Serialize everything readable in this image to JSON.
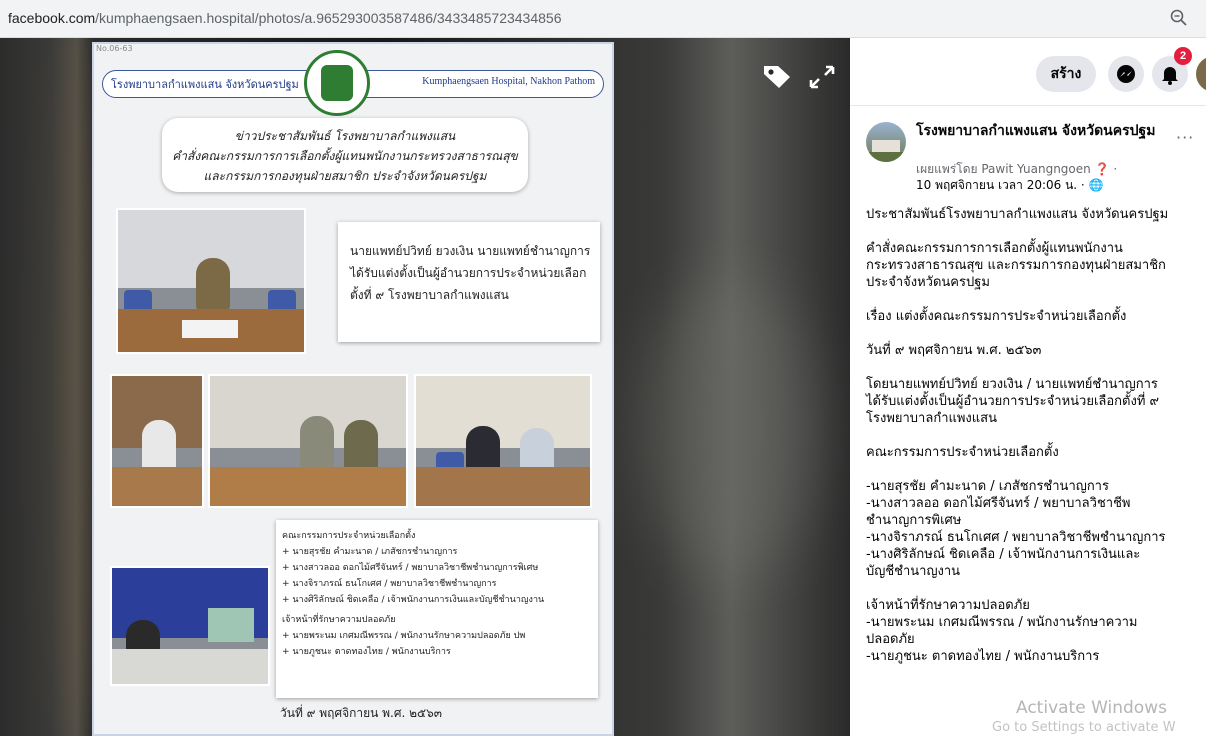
{
  "browser": {
    "url_host": "facebook.com",
    "url_path": "/kumphaengsaen.hospital/photos/a.965293003587486/3433485723434856"
  },
  "photo": {
    "tiny_label": "No.06-63",
    "header_left": "โรงพยาบาลกำแพงแสน จังหวัดนครปฐม",
    "header_right": "Kumphaengsaen Hospital, Nakhon Pathom",
    "headline": [
      "ข่าวประชาสัมพันธ์ โรงพยาบาลกำแพงแสน",
      "คำสั่งคณะกรรมการการเลือกตั้งผู้แทนพนักงานกระทรวงสาธารณสุข",
      "และกรรมการกองทุนฝ่ายสมาชิก ประจำจังหวัดนครปฐม"
    ],
    "card1": [
      "นายแพทย์ปวิทย์ ยวงเงิน นายแพทย์ชำนาญการ",
      "ได้รับแต่งตั้งเป็นผู้อำนวยการประจำหน่วยเลือก",
      "ตั้งที่ ๙ โรงพยาบาลกำแพงแสน"
    ],
    "card2": [
      "คณะกรรมการประจำหน่วยเลือกตั้ง",
      "+ นายสุรชัย คำมะนาด / เภสัชกรชำนาญการ",
      "+ นางสาวลออ ดอกไม้ศรีจันทร์ / พยาบาลวิชาชีพชำนาญการพิเศษ",
      "+ นางจิราภรณ์ ธนโกเศศ / พยาบาลวิชาชีพชำนาญการ",
      "+ นางศิริลักษณ์ ชิดเคลือ / เจ้าพนักงานการเงินและบัญชีชำนาญงาน",
      "เจ้าหน้าที่รักษาความปลอดภัย",
      "+ นายพระนม เกศมณีพรรณ / พนักงานรักษาความปลอดภัย ปพ",
      "+ นายภูชนะ ตาดทองไทย / พนักงานบริการ"
    ],
    "date": "วันที่ ๙ พฤศจิกายน พ.ศ. ๒๕๖๓"
  },
  "overlay_icons": [
    "tag-icon",
    "fullscreen-icon"
  ],
  "fb_topbar": {
    "create_label": "สร้าง",
    "notif_count": "2"
  },
  "post": {
    "page_name": "โรงพยาบาลกำแพงแสน จังหวัดนครปฐม",
    "published_by": "เผยแพร่โดย Pawit Yuangngoen",
    "datetime": "10 พฤศจิกายน เวลา 20:06 น. ·",
    "more": "···",
    "lines": [
      {
        "t": "ประชาสัมพันธ์โรงพยาบาลกำแพงแสน จังหวัดนครปฐม",
        "gap": false
      },
      {
        "t": "คำสั่งคณะกรรมการการเลือกตั้งผู้แทนพนักงาน",
        "gap": true
      },
      {
        "t": "กระทรวงสาธารณสุข และกรรมการกองทุนฝ่ายสมาชิก",
        "gap": false
      },
      {
        "t": "ประจำจังหวัดนครปฐม",
        "gap": false
      },
      {
        "t": "เรื่อง แต่งตั้งคณะกรรมการประจำหน่วยเลือกตั้ง",
        "gap": true
      },
      {
        "t": "วันที่ ๙ พฤศจิกายน พ.ศ. ๒๕๖๓",
        "gap": true
      },
      {
        "t": "โดยนายแพทย์ปวิทย์ ยวงเงิน / นายแพทย์ชำนาญการ",
        "gap": true
      },
      {
        "t": "ได้รับแต่งตั้งเป็นผู้อำนวยการประจำหน่วยเลือกตั้งที่ ๙",
        "gap": false
      },
      {
        "t": "โรงพยาบาลกำแพงแสน",
        "gap": false
      },
      {
        "t": "คณะกรรมการประจำหน่วยเลือกตั้ง",
        "gap": true
      },
      {
        "t": "-นายสุรชัย คำมะนาด / เภสัชกรชำนาญการ",
        "gap": true
      },
      {
        "t": "-นางสาวลออ ดอกไม้ศรีจันทร์ / พยาบาลวิชาชีพ",
        "gap": false
      },
      {
        "t": "ชำนาญการพิเศษ",
        "gap": false
      },
      {
        "t": "-นางจิราภรณ์ ธนโกเศศ / พยาบาลวิชาชีพชำนาญการ",
        "gap": false
      },
      {
        "t": "-นางศิริลักษณ์ ชิดเคลือ / เจ้าพนักงานการเงินและ",
        "gap": false
      },
      {
        "t": "บัญชีชำนาญงาน",
        "gap": false
      },
      {
        "t": "เจ้าหน้าที่รักษาความปลอดภัย",
        "gap": true
      },
      {
        "t": "-นายพระนม เกศมณีพรรณ / พนักงานรักษาความ",
        "gap": false
      },
      {
        "t": "ปลอดภัย",
        "gap": false
      },
      {
        "t": "-นายภูชนะ ตาดทองไทย / พนักงานบริการ",
        "gap": false
      }
    ]
  },
  "watermark": {
    "line1": "Activate Windows",
    "line2": "Go to Settings to activate W"
  },
  "colors": {
    "accent": "#1877f2",
    "badge": "#e41e3f",
    "button_bg": "#e4e6eb"
  }
}
